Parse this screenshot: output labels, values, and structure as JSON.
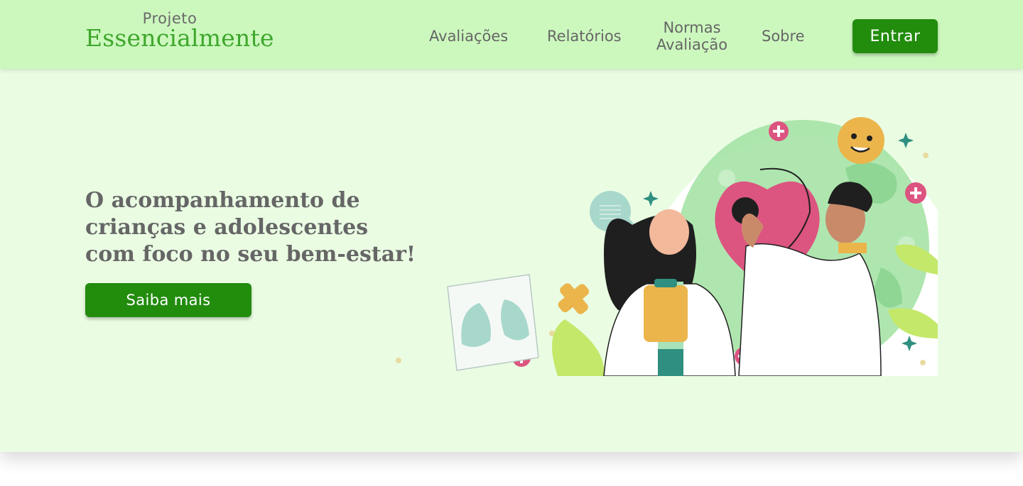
{
  "header": {
    "brand_small": "Projeto",
    "brand_big": "Essencialmente",
    "nav": [
      {
        "label": "Avaliações"
      },
      {
        "label": "Relatórios"
      },
      {
        "label": "Normas Avaliação"
      },
      {
        "label": "Sobre"
      }
    ],
    "login_label": "Entrar"
  },
  "hero": {
    "title": "O acompanhamento de crianças e adolescentes com foco no seu bem-estar!",
    "cta_label": "Saiba mais"
  },
  "colors": {
    "topbar": "#ccf8be",
    "hero_bg": "#eafde3",
    "brand_green": "#3fa72c",
    "button_green": "#228c0d",
    "text_gray": "#666666"
  }
}
